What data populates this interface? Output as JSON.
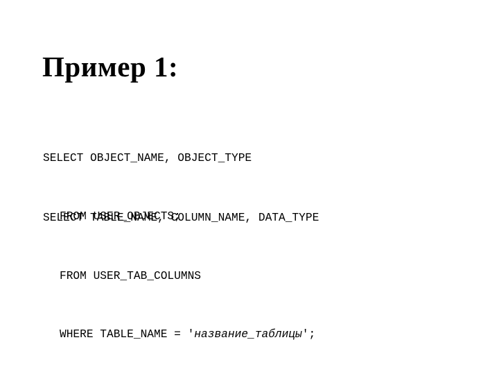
{
  "slide": {
    "title": "Пример 1:",
    "query1": {
      "line1": "SELECT OBJECT_NAME, OBJECT_TYPE",
      "line2": "FROM USER_OBJECTS;"
    },
    "query2": {
      "line1": "SELECT TABLE_NAME, COLUMN_NAME, DATA_TYPE",
      "line2": "FROM USER_TAB_COLUMNS",
      "line3_prefix": "WHERE TABLE_NAME = '",
      "line3_placeholder": "название_таблицы",
      "line3_suffix": "';"
    }
  }
}
